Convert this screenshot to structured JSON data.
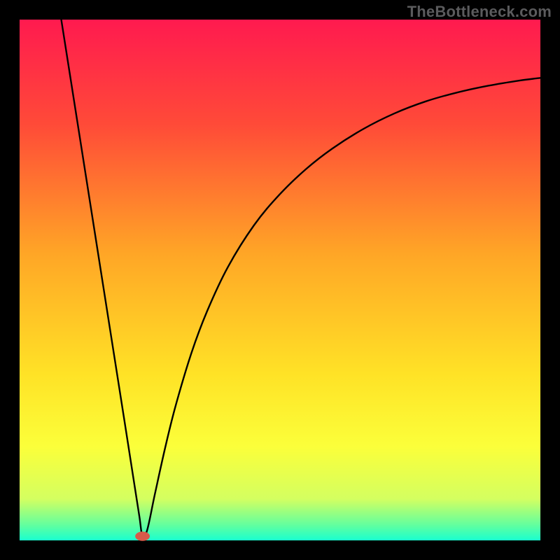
{
  "watermark": "TheBottleneck.com",
  "chart_data": {
    "type": "line",
    "title": "",
    "xlabel": "",
    "ylabel": "",
    "xlim": [
      0,
      100
    ],
    "ylim": [
      0,
      100
    ],
    "background_gradient": {
      "type": "vertical",
      "stops": [
        {
          "pos": 0.0,
          "color": "#ff1a4f"
        },
        {
          "pos": 0.2,
          "color": "#ff4a38"
        },
        {
          "pos": 0.45,
          "color": "#ffa626"
        },
        {
          "pos": 0.68,
          "color": "#ffe226"
        },
        {
          "pos": 0.82,
          "color": "#fbff3a"
        },
        {
          "pos": 0.92,
          "color": "#d4ff60"
        },
        {
          "pos": 0.97,
          "color": "#63ff9e"
        },
        {
          "pos": 1.0,
          "color": "#19ffcf"
        }
      ]
    },
    "series": [
      {
        "name": "curve",
        "color": "#000000",
        "x": [
          8.0,
          10.0,
          12.0,
          14.0,
          16.0,
          18.0,
          20.0,
          22.0,
          23.0,
          23.6,
          24.5,
          26.0,
          28.0,
          30.0,
          33.0,
          36.0,
          40.0,
          45.0,
          50.0,
          55.0,
          60.0,
          66.0,
          72.0,
          78.0,
          84.0,
          90.0,
          96.0,
          100.0
        ],
        "y": [
          100.0,
          87.3,
          74.6,
          61.9,
          49.2,
          36.5,
          23.8,
          11.0,
          4.6,
          0.8,
          2.0,
          9.0,
          18.0,
          26.0,
          36.0,
          44.0,
          52.5,
          60.5,
          66.5,
          71.3,
          75.2,
          79.0,
          82.0,
          84.3,
          86.0,
          87.3,
          88.3,
          88.8
        ]
      }
    ],
    "marker": {
      "name": "min-marker",
      "x": 23.6,
      "y": 0.8,
      "rx": 1.4,
      "ry": 0.9,
      "color": "#d85a4a"
    }
  }
}
